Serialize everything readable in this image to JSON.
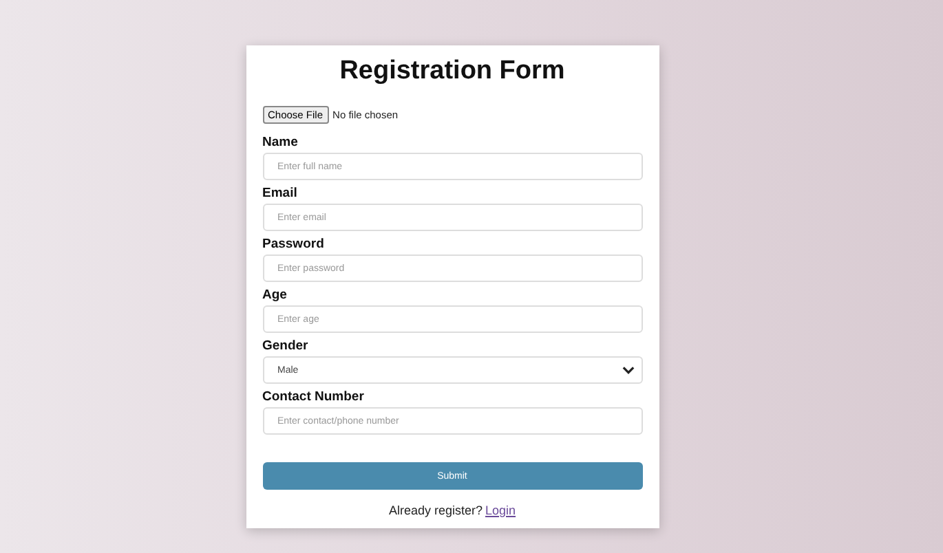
{
  "title": "Registration Form",
  "file_input": {
    "button": "Choose File",
    "status": "No file chosen"
  },
  "fields": [
    {
      "kind": "input",
      "label": "Name",
      "placeholder": "Enter full name"
    },
    {
      "kind": "input",
      "label": "Email",
      "placeholder": "Enter email"
    },
    {
      "kind": "input",
      "label": "Password",
      "placeholder": "Enter password"
    },
    {
      "kind": "input",
      "label": "Age",
      "placeholder": "Enter age"
    },
    {
      "kind": "select",
      "label": "Gender",
      "value": "Male"
    },
    {
      "kind": "input",
      "label": "Contact Number",
      "placeholder": "Enter contact/phone number"
    }
  ],
  "submit": "Submit",
  "footer": {
    "text": "Already register?",
    "link": "Login"
  }
}
